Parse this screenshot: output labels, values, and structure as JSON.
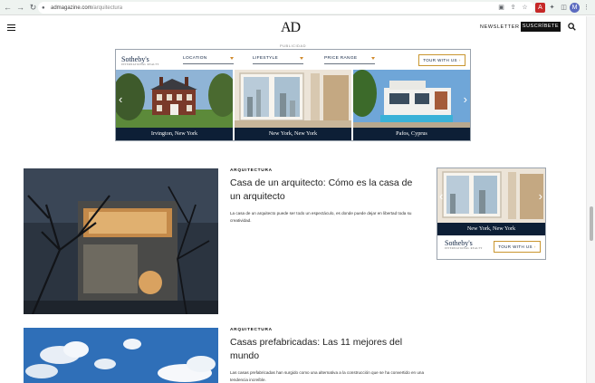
{
  "browser": {
    "url_domain": "admagazine.com",
    "url_path": "/arquitectura",
    "back_icon": "arrow-left-icon",
    "forward_icon": "arrow-right-icon",
    "reload_icon": "reload-icon"
  },
  "header": {
    "logo": "AD",
    "newsletter_label": "NEWSLETTER",
    "subscribe_label": "SUSCRÍBETE"
  },
  "ad_label": "PUBLICIDAD",
  "banner_ad": {
    "brand": "Sotheby's",
    "brand_sub": "INTERNATIONAL REALTY",
    "filters": [
      "LOCATION",
      "LIFESTYLE",
      "PRICE RANGE"
    ],
    "tour_label": "TOUR WITH US",
    "slides": [
      "Irvington, New York",
      "New York, New York",
      "Pafos, Cyprus"
    ]
  },
  "articles": [
    {
      "kicker": "ARQUITECTURA",
      "title": "Casa de un arquitecto: Cómo es la casa de un arquitecto",
      "dek": "La casa de un arquitecto puede ser todo un espectáculo, es donde puede dejar en libertad toda su creatividad."
    },
    {
      "kicker": "ARQUITECTURA",
      "title": "Casas prefabricadas: Las 11 mejores del mundo",
      "dek": "Las casas prefabricadas han surgido como una alternativa a la construcción que se ha convertido en una tendencia increíble."
    }
  ],
  "side_ad": {
    "caption": "New York, New York",
    "brand": "Sotheby's",
    "brand_sub": "INTERNATIONAL REALTY",
    "tour_label": "TOUR WITH US"
  },
  "colors": {
    "navy": "#0d1f36",
    "gold": "#c9962f",
    "chrome": "#eef3f0"
  }
}
